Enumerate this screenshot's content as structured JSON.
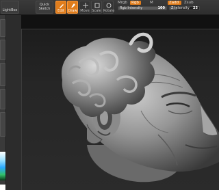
{
  "toolbar": {
    "lightbox": "LightBox",
    "quick_sketch_line1": "Quick",
    "quick_sketch_line2": "Sketch",
    "edit": "Edit",
    "draw": "Draw",
    "move": "Move",
    "scale": "Scale",
    "rotate": "Rotate",
    "mrgb": "Mrgb",
    "rgb": "Rgb",
    "m": "M",
    "rgb_intensity_label": "Rgb Intensity",
    "rgb_intensity_value": "100",
    "zadd": "Zadd",
    "zsub": "Zsub",
    "z_intensity_label": "Z Intensity",
    "z_intensity_value": "25",
    "rgb_intensity_level": 1.0,
    "z_intensity_level": 0.25
  },
  "colors": {
    "accent": "#e07d1c",
    "canvas_bg": "#1a1a1a",
    "model": "#9a9a9a"
  },
  "canvas": {
    "model_icon": "sculpted-head-model"
  }
}
